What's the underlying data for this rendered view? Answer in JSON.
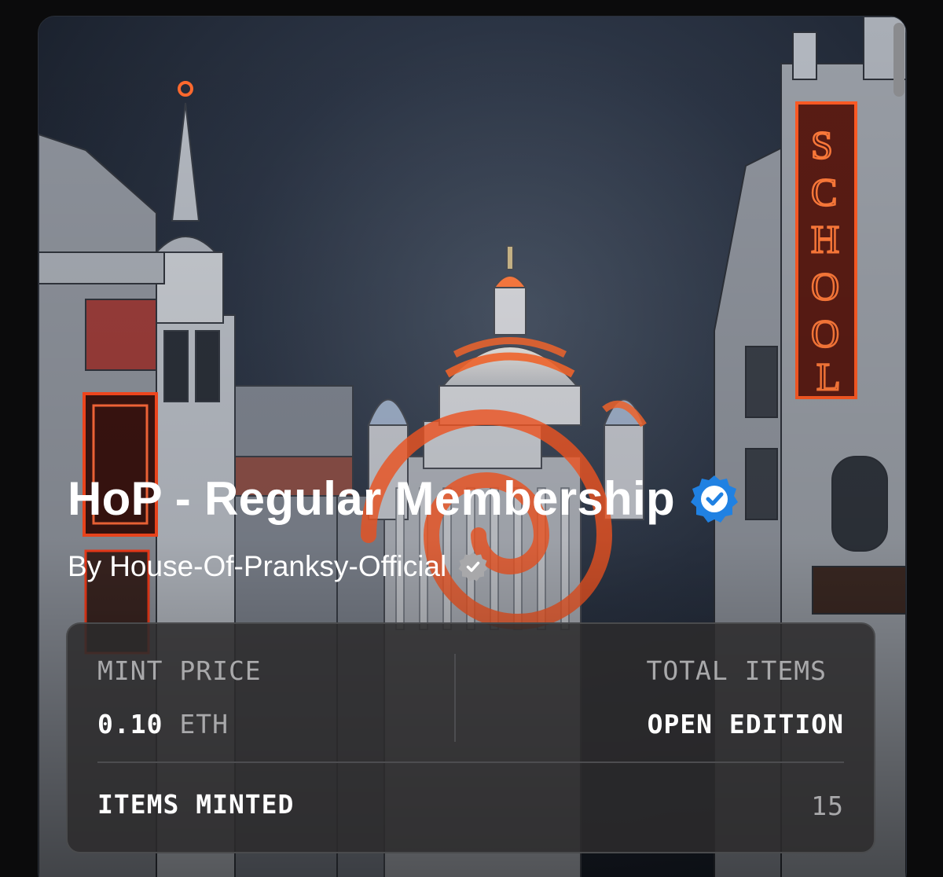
{
  "collection": {
    "title": "HoP - Regular Membership",
    "verified": true,
    "byline_prefix": "By",
    "creator": "House-Of-Pranksy-Official",
    "creator_verified": true,
    "artwork_sign_text": "SCHOOL"
  },
  "stats": {
    "mint_price_label": "MINT PRICE",
    "mint_price_amount": "0.10",
    "mint_price_unit": "ETH",
    "total_items_label": "TOTAL ITEMS",
    "total_items_value": "OPEN EDITION",
    "items_minted_label": "ITEMS MINTED",
    "items_minted_value": "15"
  },
  "colors": {
    "verified_blue": "#2081e2",
    "creator_badge_gray": "#a8a8aa",
    "neon_orange": "#ff6a2e",
    "sky_top": "#1c2433",
    "panel_bg": "#2c2b2c"
  },
  "icons": {
    "verified": "verified-check-icon",
    "creator_verified": "creator-verified-check-icon"
  }
}
